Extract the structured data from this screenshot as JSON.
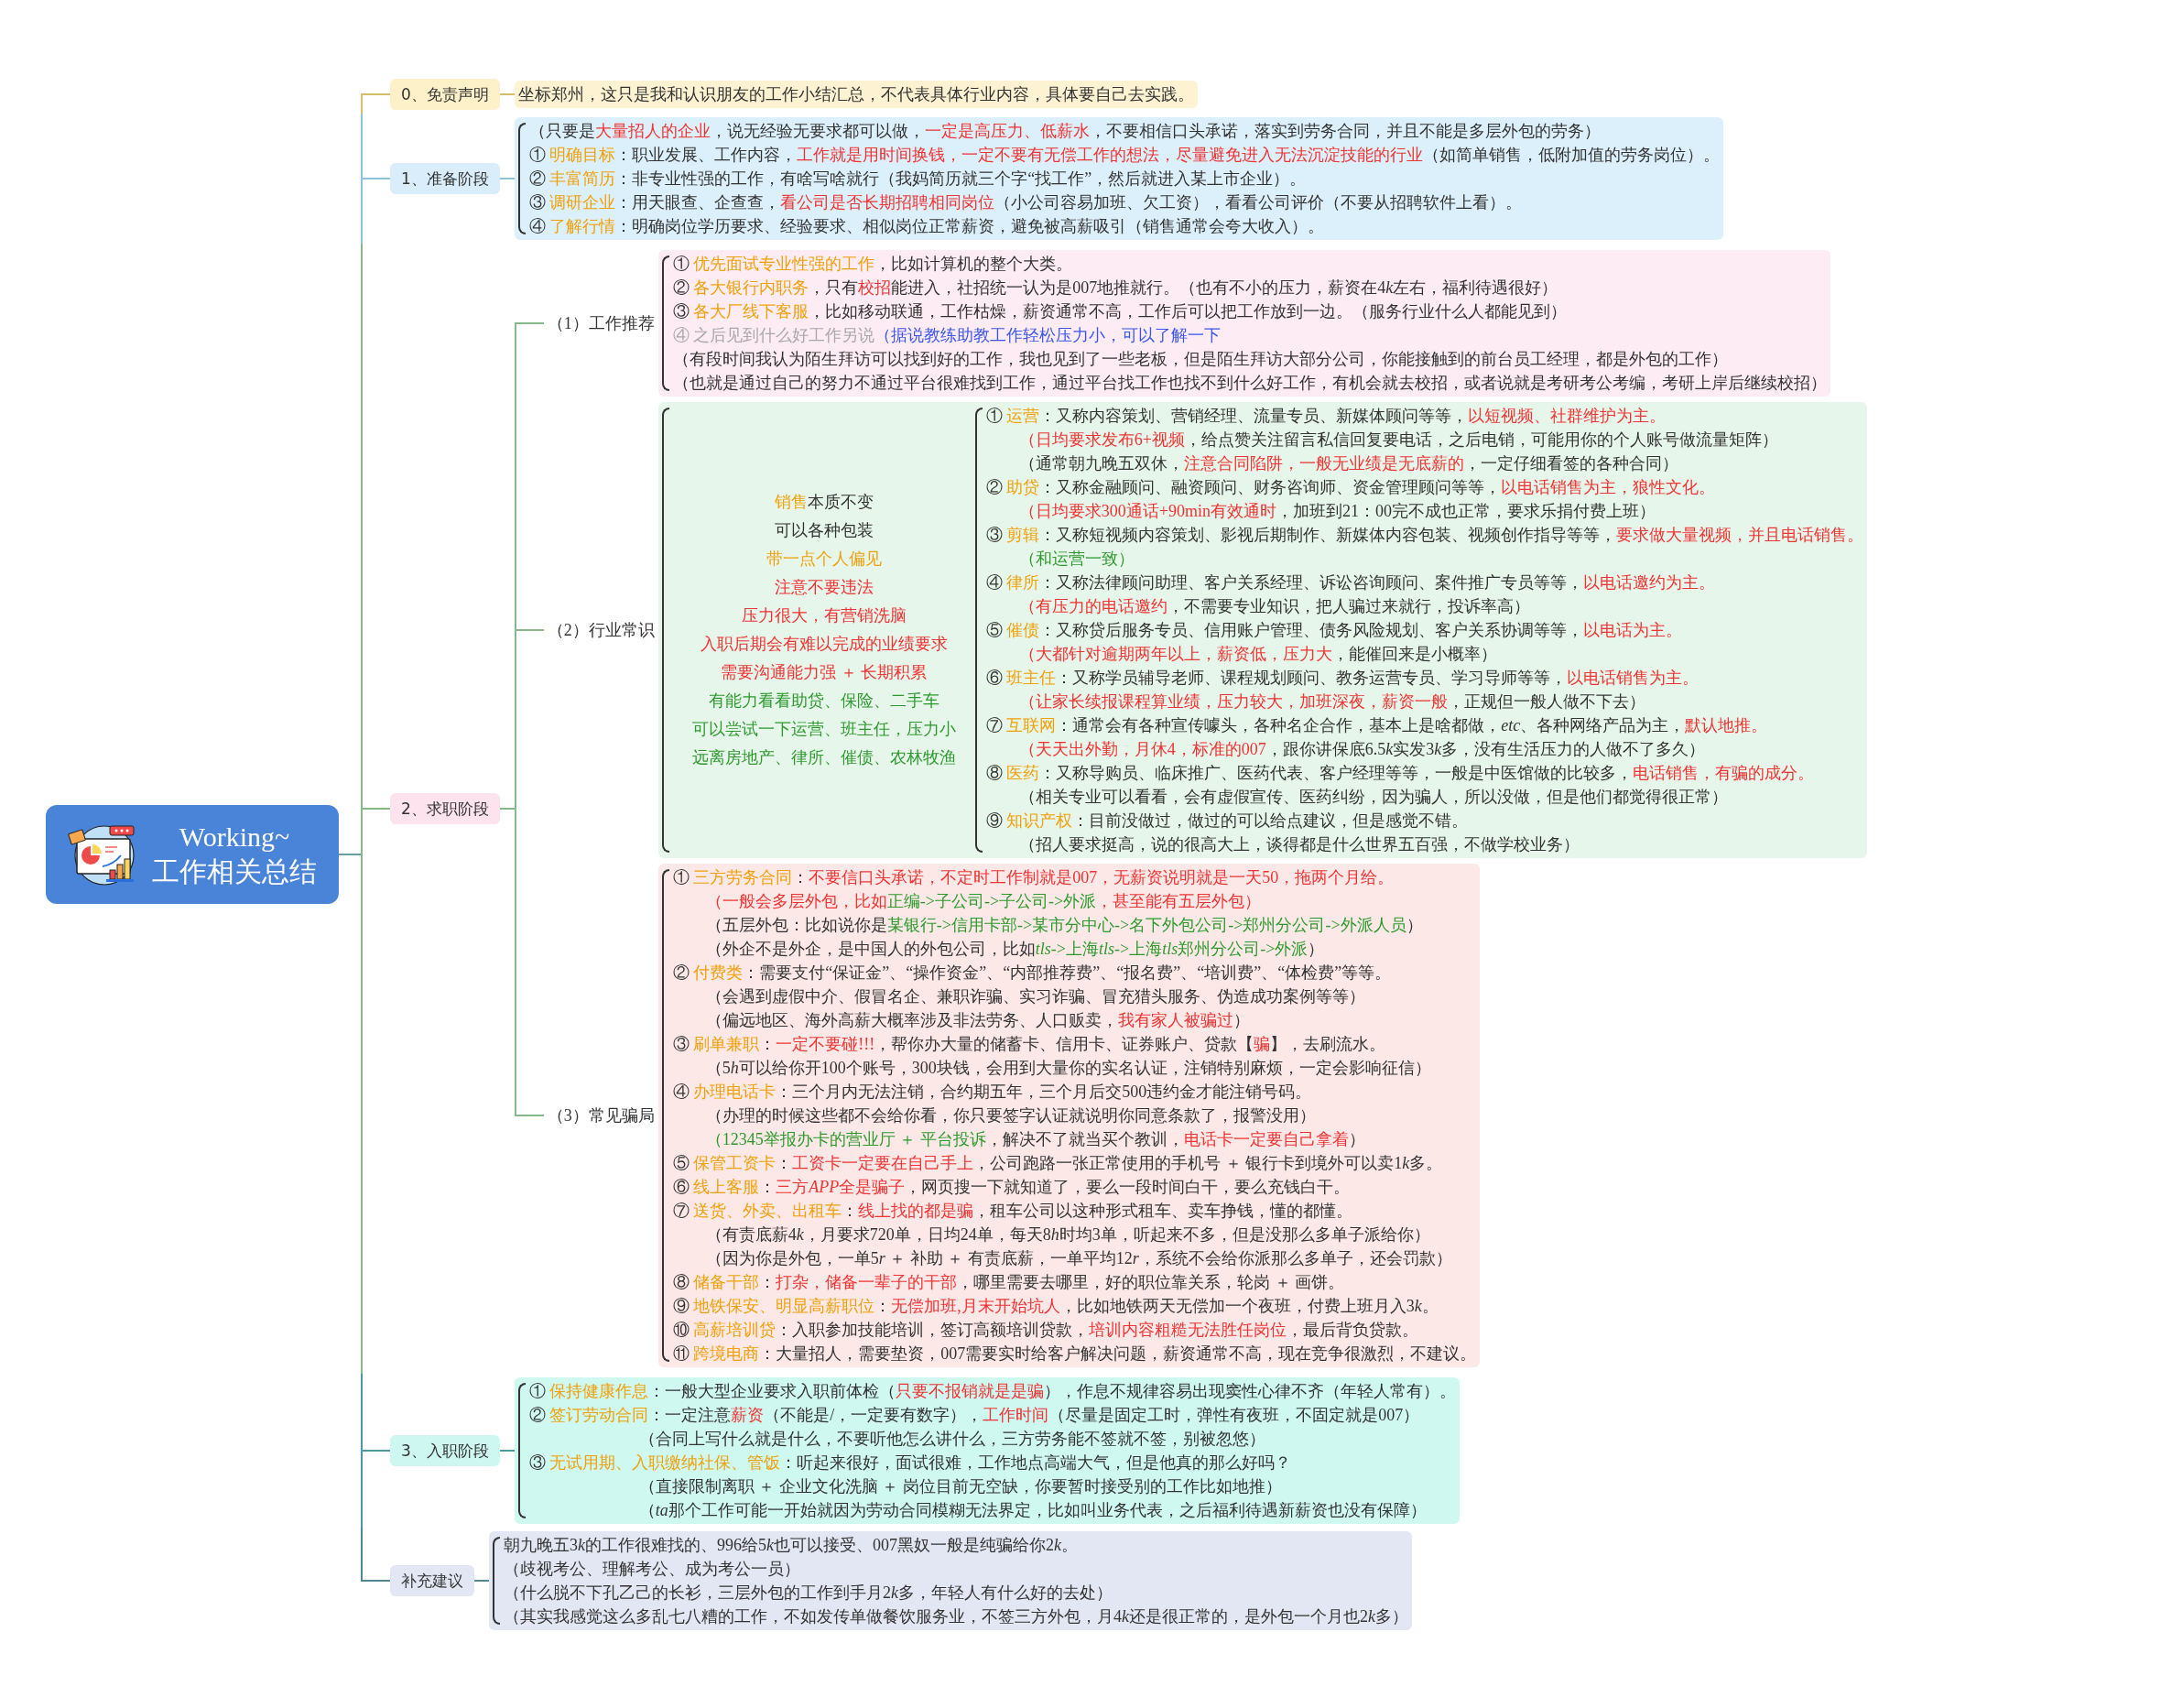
{
  "root": {
    "title": "Working~",
    "subtitle": "工作相关总结"
  },
  "branches": [
    {
      "label": "0、免责声明",
      "lines": [
        {
          "segments": [
            "坐标郑州，这只是我和认识朋友的工作小结汇总，不代表具体行业内容，具体要自己去实践。"
          ]
        }
      ]
    },
    {
      "label": "1、准备阶段",
      "lines": [
        {
          "segments": [
            "（只要是",
            {
              "kind": "warn",
              "text": "大量招人的企业"
            },
            "，说无经验无要求都可以做，",
            {
              "kind": "warn",
              "text": "一定是高压力、低薪水"
            },
            "，不要相信口头承诺，落实到劳务合同，并且不能是多层外包的劳务）"
          ]
        },
        {
          "segments": [
            "① ",
            {
              "kind": "key",
              "text": "明确目标"
            },
            "：职业发展、工作内容，",
            {
              "kind": "warn",
              "text": "工作就是用时间换钱，一定不要有无偿工作的想法，尽量避免进入无法沉淀技能的行业"
            },
            "（如简单销售，低附加值的劳务岗位）。"
          ]
        },
        {
          "segments": [
            "② ",
            {
              "kind": "key",
              "text": "丰富简历"
            },
            "：非专业性强的工作，有啥写啥就行（我妈简历就三个字“找工作”，然后就进入某上市企业）。"
          ]
        },
        {
          "segments": [
            "③ ",
            {
              "kind": "key",
              "text": "调研企业"
            },
            "：用天眼查、企查查，",
            {
              "kind": "warn",
              "text": "看公司是否长期招聘相同岗位"
            },
            "（小公司容易加班、欠工资），看看公司评价（不要从招聘软件上看）。"
          ]
        },
        {
          "segments": [
            "④ ",
            {
              "kind": "key",
              "text": "了解行情"
            },
            "：明确岗位学历要求、经验要求、相似岗位正常薪资，避免被高薪吸引（销售通常会夸大收入）。"
          ]
        }
      ]
    },
    {
      "label": "2、求职阶段",
      "subbranches": [
        {
          "label": "（1）工作推荐",
          "lines": [
            {
              "segments": [
                "① ",
                {
                  "kind": "key",
                  "text": "优先面试专业性强的工作"
                },
                "，比如计算机的整个大类。"
              ]
            },
            {
              "segments": [
                "② ",
                {
                  "kind": "key",
                  "text": "各大银行内职务"
                },
                "，只有",
                {
                  "kind": "warn",
                  "text": "校招"
                },
                "能进入，社招统一认为是007地推就行。（也有不小的压力，薪资在4",
                {
                  "kind": "plain",
                  "italic": true,
                  "text": "k"
                },
                "左右，福利待遇很好）"
              ]
            },
            {
              "segments": [
                "③ ",
                {
                  "kind": "key",
                  "text": "各大厂线下客服"
                },
                "，比如移动联通，工作枯燥，薪资通常不高，工作后可以把工作放到一边。（服务行业什么人都能见到）"
              ]
            },
            {
              "segments": [
                {
                  "kind": "muted",
                  "text": "④ 之后见到什么好工作另说"
                },
                {
                  "kind": "note",
                  "text": "（据说教练助教工作轻松压力小，可以了解一下"
                }
              ]
            },
            {
              "segments": [
                "（有段时间我认为陌生拜访可以找到好的工作，我也见到了一些老板，但是陌生拜访大部分公司，你能接触到的前台员工经理，都是外包的工作）"
              ]
            },
            {
              "segments": [
                "（也就是通过自己的努力不通过平台很难找到工作，通过平台找工作也找不到什么好工作，有机会就去校招，或者说就是考研考公考编，考研上岸后继续校招）"
              ]
            }
          ]
        },
        {
          "label": "（2）行业常识",
          "summary": [
            {
              "segments": [
                {
                  "kind": "key",
                  "text": "销售"
                },
                "本质不变"
              ]
            },
            {
              "segments": [
                "可以各种包装"
              ]
            },
            {
              "segments": [
                {
                  "kind": "key",
                  "text": "带一点个人偏见"
                }
              ]
            },
            {
              "segments": [
                {
                  "kind": "warn",
                  "text": "注意不要违法"
                }
              ]
            },
            {
              "segments": [
                {
                  "kind": "warn",
                  "text": "压力很大，有营销洗脑"
                }
              ]
            },
            {
              "segments": [
                {
                  "kind": "warn",
                  "text": "入职后期会有难以完成的业绩要求"
                }
              ]
            },
            {
              "segments": [
                {
                  "kind": "warn",
                  "text": "需要沟通能力强 ＋ 长期积累"
                }
              ]
            },
            {
              "segments": [
                {
                  "kind": "good",
                  "text": "有能力看看助贷、保险、二手车"
                }
              ]
            },
            {
              "segments": [
                {
                  "kind": "good",
                  "text": "可以尝试一下运营、班主任，压力小"
                }
              ]
            },
            {
              "segments": [
                {
                  "kind": "good",
                  "text": "远离房地产、律所、催债、农林牧渔"
                }
              ]
            }
          ],
          "lines": [
            {
              "segments": [
                "① ",
                {
                  "kind": "key",
                  "text": "运营"
                },
                "：又称内容策划、营销经理、流量专员、新媒体顾问等等，",
                {
                  "kind": "warn",
                  "text": "以短视频、社群维护为主。"
                }
              ],
              "children": [
                {
                  "segments": [
                    {
                      "kind": "warn",
                      "text": "（日均要求发布6+视频"
                    },
                    "，给点赞关注留言私信回复要电话，之后电销，可能用你的个人账号做流量矩阵）"
                  ]
                },
                {
                  "segments": [
                    "（通常朝九晚五双休，",
                    {
                      "kind": "warn",
                      "text": "注意合同陷阱，一般无业绩是无底薪的"
                    },
                    "，一定仔细看签的各种合同）"
                  ]
                }
              ]
            },
            {
              "segments": [
                "② ",
                {
                  "kind": "key",
                  "text": "助贷"
                },
                "：又称金融顾问、融资顾问、财务咨询师、资金管理顾问等等，",
                {
                  "kind": "warn",
                  "text": "以电话销售为主，狼性文化。"
                }
              ],
              "children": [
                {
                  "segments": [
                    {
                      "kind": "warn",
                      "text": "（日均要求300通话+90min有效通时"
                    },
                    "，加班到21：00完不成也正常，要求乐捐付费上班）"
                  ]
                }
              ]
            },
            {
              "segments": [
                "③ ",
                {
                  "kind": "key",
                  "text": "剪辑"
                },
                "：又称短视频内容策划、影视后期制作、新媒体内容包装、视频创作指导等等，",
                {
                  "kind": "warn",
                  "text": "要求做大量视频，并且电话销售。"
                }
              ],
              "children": [
                {
                  "segments": [
                    {
                      "kind": "good",
                      "text": "（和运营一致）"
                    }
                  ]
                }
              ]
            },
            {
              "segments": [
                "④ ",
                {
                  "kind": "key",
                  "text": "律所"
                },
                "：又称法律顾问助理、客户关系经理、诉讼咨询顾问、案件推广专员等等，",
                {
                  "kind": "warn",
                  "text": "以电话邀约为主。"
                }
              ],
              "children": [
                {
                  "segments": [
                    {
                      "kind": "warn",
                      "text": "（有压力的电话邀约"
                    },
                    "，不需要专业知识，把人骗过来就行，投诉率高）"
                  ]
                }
              ]
            },
            {
              "segments": [
                "⑤ ",
                {
                  "kind": "key",
                  "text": "催债"
                },
                "：又称贷后服务专员、信用账户管理、债务风险规划、客户关系协调等等，",
                {
                  "kind": "warn",
                  "text": "以电话为主。"
                }
              ],
              "children": [
                {
                  "segments": [
                    {
                      "kind": "warn",
                      "text": "（大都针对逾期两年以上，薪资低，压力大"
                    },
                    "，能催回来是小概率）"
                  ]
                }
              ]
            },
            {
              "segments": [
                "⑥ ",
                {
                  "kind": "key",
                  "text": "班主任"
                },
                "：又称学员辅导老师、课程规划顾问、教务运营专员、学习导师等等，",
                {
                  "kind": "warn",
                  "text": "以电话销售为主。"
                }
              ],
              "children": [
                {
                  "segments": [
                    {
                      "kind": "warn",
                      "text": "（让家长续报课程算业绩，压力较大，加班深夜，薪资一般"
                    },
                    "，正规但一般人做不下去）"
                  ]
                }
              ]
            },
            {
              "segments": [
                "⑦ ",
                {
                  "kind": "key",
                  "text": "互联网"
                },
                "：通常会有各种宣传噱头，各种名企合作，基本上是啥都做，*etc*、各种网络产品为主，",
                {
                  "kind": "warn",
                  "text": "默认地推。"
                }
              ],
              "children": [
                {
                  "segments": [
                    {
                      "kind": "warn",
                      "text": "（天天出外勤，月休4，标准的007"
                    },
                    "，跟你讲保底6.5",
                    {
                      "kind": "plain",
                      "italic": true,
                      "text": "k"
                    },
                    "实发3",
                    {
                      "kind": "plain",
                      "italic": true,
                      "text": "k"
                    },
                    "多，没有生活压力的人做不了多久）"
                  ]
                }
              ]
            },
            {
              "segments": [
                "⑧ ",
                {
                  "kind": "key",
                  "text": "医药"
                },
                "：又称导购员、临床推广、医药代表、客户经理等等，一般是中医馆做的比较多，",
                {
                  "kind": "warn",
                  "text": "电话销售，有骗的成分。"
                }
              ],
              "children": [
                {
                  "segments": [
                    "（相关专业可以看看，会有虚假宣传、医药纠纷，因为骗人，所以没做，但是他们都觉得很正常）"
                  ]
                }
              ]
            },
            {
              "segments": [
                "⑨ ",
                {
                  "kind": "key",
                  "text": "知识产权"
                },
                "：目前没做过，做过的可以给点建议，但是感觉不错。"
              ],
              "children": [
                {
                  "segments": [
                    "（招人要求挺高，说的很高大上，谈得都是什么世界五百强，不做学校业务）"
                  ]
                }
              ]
            }
          ]
        },
        {
          "label": "（3）常见骗局",
          "lines": [
            {
              "segments": [
                "① ",
                {
                  "kind": "key",
                  "text": "三方劳务合同"
                },
                "：",
                {
                  "kind": "warn",
                  "text": "不要信口头承诺，不定时工作制就是007，无薪资说明就是一天50，拖两个月给。"
                }
              ],
              "children": [
                {
                  "segments": [
                    {
                      "kind": "warn",
                      "text": "（一般会多层外包，比如"
                    },
                    {
                      "kind": "good",
                      "text": "正编->子公司->子公司->外派"
                    },
                    {
                      "kind": "warn",
                      "text": "，甚至能有五层外包）"
                    }
                  ]
                },
                {
                  "segments": [
                    "（五层外包：比如说你是",
                    {
                      "kind": "good",
                      "text": "某银行->信用卡部->某市分中心->名下外包公司->郑州分公司->外派人员"
                    },
                    "）"
                  ]
                },
                {
                  "segments": [
                    "（外企不是外企，是中国人的外包公司，比如",
                    {
                      "kind": "good",
                      "italic": true,
                      "text": "tls"
                    },
                    {
                      "kind": "good",
                      "text": "->上海"
                    },
                    {
                      "kind": "good",
                      "italic": true,
                      "text": "tls"
                    },
                    {
                      "kind": "good",
                      "text": "->上海"
                    },
                    {
                      "kind": "good",
                      "italic": true,
                      "text": "tls"
                    },
                    {
                      "kind": "good",
                      "text": "郑州分公司->外派"
                    },
                    "）"
                  ]
                }
              ]
            },
            {
              "segments": [
                "② ",
                {
                  "kind": "key",
                  "text": "付费类"
                },
                "：需要支付“保证金”、“操作资金”、“内部推荐费”、“报名费”、“培训费”、“体检费”等等。"
              ],
              "children": [
                {
                  "segments": [
                    "（会遇到虚假中介、假冒名企、兼职诈骗、实习诈骗、冒充猎头服务、伪造成功案例等等）"
                  ]
                },
                {
                  "segments": [
                    "（偏远地区、海外高薪大概率涉及非法劳务、人口贩卖，",
                    {
                      "kind": "warn",
                      "text": "我有家人被骗过"
                    },
                    "）"
                  ]
                }
              ]
            },
            {
              "segments": [
                "③ ",
                {
                  "kind": "key",
                  "text": "刷单兼职"
                },
                "：",
                {
                  "kind": "warn",
                  "text": "一定不要碰!!!"
                },
                "，帮你办大量的储蓄卡、信用卡、证券账户、贷款【",
                {
                  "kind": "warn",
                  "text": "骗"
                },
                "】，去刷流水。"
              ],
              "children": [
                {
                  "segments": [
                    "（5",
                    {
                      "kind": "plain",
                      "italic": true,
                      "text": "h"
                    },
                    "可以给你开100个账号，300块钱，会用到大量你的实名认证，注销特别麻烦，一定会影响征信）"
                  ]
                }
              ]
            },
            {
              "segments": [
                "④ ",
                {
                  "kind": "key",
                  "text": "办理电话卡"
                },
                "：三个月内无法注销，合约期五年，三个月后交500违约金才能注销号码。"
              ],
              "children": [
                {
                  "segments": [
                    "（办理的时候这些都不会给你看，你只要签字认证就说明你同意条款了，报警没用）"
                  ]
                },
                {
                  "segments": [
                    {
                      "kind": "good",
                      "text": "（12345举报办卡的营业厅 ＋ 平台投诉"
                    },
                    "，解决不了就当买个教训，",
                    {
                      "kind": "warn",
                      "text": "电话卡一定要自己拿着"
                    },
                    "）"
                  ]
                }
              ]
            },
            {
              "segments": [
                "⑤ ",
                {
                  "kind": "key",
                  "text": "保管工资卡"
                },
                "：",
                {
                  "kind": "warn",
                  "text": "工资卡一定要在自己手上"
                },
                "，公司跑路一张正常使用的手机号 ＋ 银行卡到境外可以卖1",
                {
                  "kind": "plain",
                  "italic": true,
                  "text": "k"
                },
                "多。"
              ]
            },
            {
              "segments": [
                "⑥ ",
                {
                  "kind": "key",
                  "text": "线上客服"
                },
                "：",
                {
                  "kind": "warn",
                  "text": "三方"
                },
                {
                  "kind": "warn",
                  "italic": true,
                  "text": "APP"
                },
                {
                  "kind": "warn",
                  "text": "全是骗子"
                },
                "，网页搜一下就知道了，要么一段时间白干，要么充钱白干。"
              ]
            },
            {
              "segments": [
                "⑦ ",
                {
                  "kind": "key",
                  "text": "送货、外卖、出租车"
                },
                "：",
                {
                  "kind": "warn",
                  "text": "线上找的都是骗"
                },
                "，租车公司以这种形式租车、卖车挣钱，懂的都懂。"
              ],
              "children": [
                {
                  "segments": [
                    "（有责底薪4",
                    {
                      "kind": "plain",
                      "italic": true,
                      "text": "k"
                    },
                    "，月要求720单，日均24单，每天8",
                    {
                      "kind": "plain",
                      "italic": true,
                      "text": "h"
                    },
                    "时均3单，听起来不多，但是没那么多单子派给你）"
                  ]
                },
                {
                  "segments": [
                    "（因为你是外包，一单5",
                    {
                      "kind": "plain",
                      "italic": true,
                      "text": "r"
                    },
                    " ＋ 补助 ＋ 有责底薪，一单平均12",
                    {
                      "kind": "plain",
                      "italic": true,
                      "text": "r"
                    },
                    "，系统不会给你派那么多单子，还会罚款）"
                  ]
                }
              ]
            },
            {
              "segments": [
                "⑧ ",
                {
                  "kind": "key",
                  "text": "储备干部"
                },
                "：",
                {
                  "kind": "warn",
                  "text": "打杂，储备一辈子的干部"
                },
                "，哪里需要去哪里，好的职位靠关系，轮岗 ＋ 画饼。"
              ]
            },
            {
              "segments": [
                "⑨ ",
                {
                  "kind": "key",
                  "text": "地铁保安、明显高薪职位"
                },
                "：",
                {
                  "kind": "warn",
                  "text": "无偿加班,月末开始坑人"
                },
                "，比如地铁两天无偿加一个夜班，付费上班月入3",
                {
                  "kind": "plain",
                  "italic": true,
                  "text": "k"
                },
                "。"
              ]
            },
            {
              "segments": [
                "⑩ ",
                {
                  "kind": "key",
                  "text": "高薪培训贷"
                },
                "：入职参加技能培训，签订高额培训贷款，",
                {
                  "kind": "warn",
                  "text": "培训内容粗糙无法胜任岗位"
                },
                "，最后背负贷款。"
              ]
            },
            {
              "segments": [
                "⑪ ",
                {
                  "kind": "key",
                  "text": "跨境电商"
                },
                "：大量招人，需要垫资，007需要实时给客户解决问题，薪资通常不高，现在竞争很激烈，不建议。"
              ]
            }
          ]
        }
      ]
    },
    {
      "label": "3、入职阶段",
      "lines": [
        {
          "segments": [
            "① ",
            {
              "kind": "key",
              "text": "保持健康作息"
            },
            "：一般大型企业要求入职前体检（",
            {
              "kind": "warn",
              "text": "只要不报销就是是骗"
            },
            "），作息不规律容易出现窦性心律不齐（年轻人常有）。"
          ]
        },
        {
          "segments": [
            "② ",
            {
              "kind": "key",
              "text": "签订劳动合同"
            },
            "：一定注意",
            {
              "kind": "warn",
              "text": "薪资"
            },
            "（不能是/，一定要有数字），",
            {
              "kind": "warn",
              "text": "工作时间"
            },
            "（尽量是固定工时，弹性有夜班，不固定就是007）"
          ],
          "children": [
            {
              "segments": [
                "（合同上写什么就是什么，不要听他怎么讲什么，三方劳务能不签就不签，别被忽悠）"
              ]
            }
          ]
        },
        {
          "segments": [
            "③ ",
            {
              "kind": "key",
              "text": "无试用期、入职缴纳社保、管饭"
            },
            "：听起来很好，面试很难，工作地点高端大气，但是他真的那么好吗？"
          ],
          "children": [
            {
              "segments": [
                "（直接限制离职 ＋ 企业文化洗脑 ＋ 岗位目前无空缺，你要暂时接受别的工作比如地推）"
              ]
            },
            {
              "segments": [
                "（",
                {
                  "kind": "plain",
                  "italic": true,
                  "text": "ta"
                },
                "那个工作可能一开始就因为劳动合同模糊无法界定，比如叫业务代表，之后福利待遇新薪资也没有保障）"
              ]
            }
          ]
        }
      ]
    },
    {
      "label": "补充建议",
      "lines": [
        {
          "segments": [
            "朝九晚五3",
            {
              "kind": "plain",
              "italic": true,
              "text": "k"
            },
            "的工作很难找的、996给5",
            {
              "kind": "plain",
              "italic": true,
              "text": "k"
            },
            "也可以接受、007黑奴一般是纯骗给你2",
            {
              "kind": "plain",
              "italic": true,
              "text": "k"
            },
            "。"
          ]
        },
        {
          "segments": [
            "（歧视考公、理解考公、成为考公一员）"
          ]
        },
        {
          "segments": [
            "（什么脱不下孔乙己的长衫，三层外包的工作到手月2",
            {
              "kind": "plain",
              "italic": true,
              "text": "k"
            },
            "多，年轻人有什么好的去处）"
          ]
        },
        {
          "segments": [
            "（其实我感觉这么多乱七八糟的工作，不如发传单做餐饮服务业，不签三方外包，月4",
            {
              "kind": "plain",
              "italic": true,
              "text": "k"
            },
            "还是很正常的，是外包一个月也2",
            {
              "kind": "plain",
              "italic": true,
              "text": "k"
            },
            "多）"
          ]
        }
      ]
    }
  ]
}
